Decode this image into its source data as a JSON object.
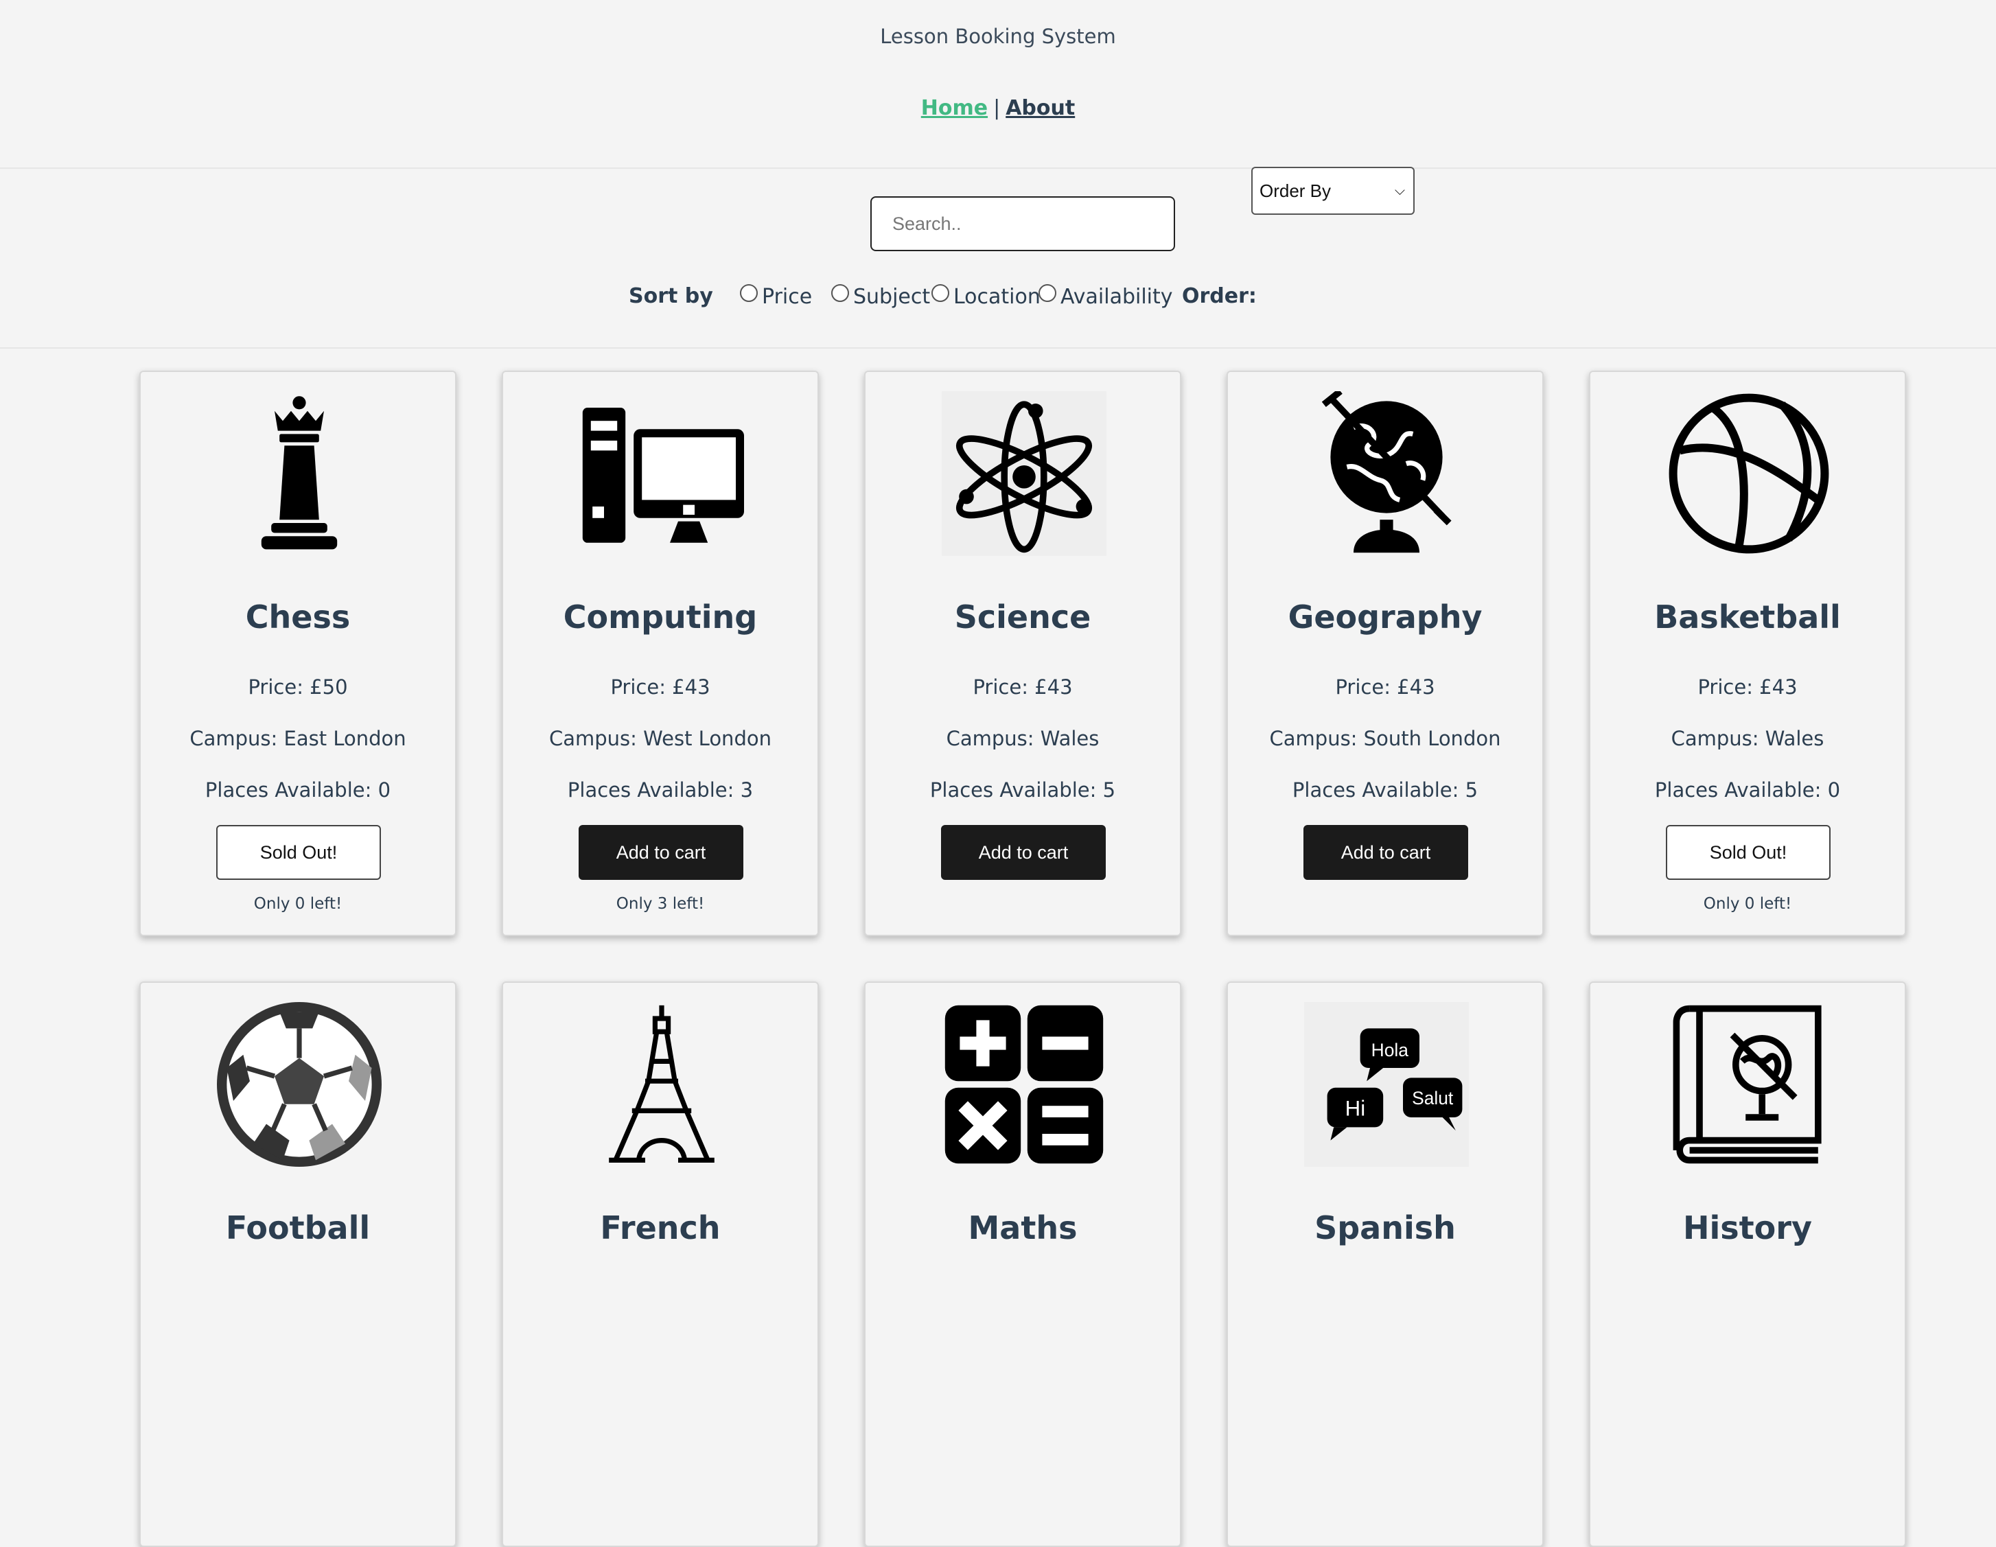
{
  "app_title": "Lesson Booking System",
  "nav": {
    "home": "Home",
    "separator": "|",
    "about": "About"
  },
  "search": {
    "placeholder": "Search.."
  },
  "sort": {
    "label": "Sort by",
    "options": [
      "Price",
      "Subject",
      "Location",
      "Availability"
    ],
    "order_label": "Order:",
    "order_value": "Order By"
  },
  "colors": {
    "nav_active": "#42b983",
    "button_dark": "#1b1b1b",
    "text": "#2c3e50"
  },
  "lessons": [
    {
      "icon": "chess-queen-icon",
      "subject": "Chess",
      "price": "Price: £50",
      "campus": "Campus: East London",
      "places": "Places Available: 0",
      "button": "Sold Out!",
      "left": "Only 0 left!"
    },
    {
      "icon": "computer-icon",
      "subject": "Computing",
      "price": "Price: £43",
      "campus": "Campus: West London",
      "places": "Places Available: 3",
      "button": "Add to cart",
      "left": "Only 3 left!"
    },
    {
      "icon": "atom-icon",
      "subject": "Science",
      "price": "Price: £43",
      "campus": "Campus: Wales",
      "places": "Places Available: 5",
      "button": "Add to cart",
      "left": ""
    },
    {
      "icon": "globe-icon",
      "subject": "Geography",
      "price": "Price: £43",
      "campus": "Campus: South London",
      "places": "Places Available: 5",
      "button": "Add to cart",
      "left": ""
    },
    {
      "icon": "basketball-icon",
      "subject": "Basketball",
      "price": "Price: £43",
      "campus": "Campus: Wales",
      "places": "Places Available: 0",
      "button": "Sold Out!",
      "left": "Only 0 left!"
    },
    {
      "icon": "football-icon",
      "subject": "Football"
    },
    {
      "icon": "eiffel-tower-icon",
      "subject": "French"
    },
    {
      "icon": "calculator-symbols-icon",
      "subject": "Maths"
    },
    {
      "icon": "speech-bubbles-icon",
      "subject": "Spanish",
      "bubbles": [
        "Hola",
        "Hi",
        "Salut"
      ]
    },
    {
      "icon": "history-book-icon",
      "subject": "History"
    }
  ]
}
